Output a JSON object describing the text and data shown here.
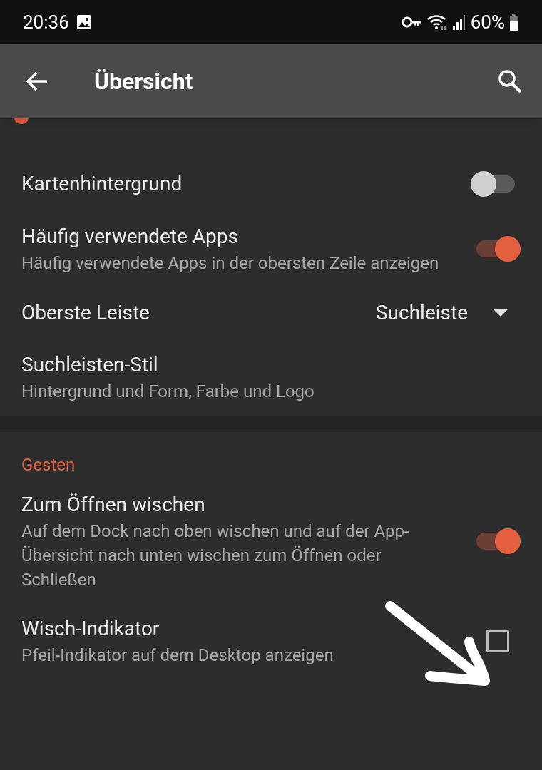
{
  "status_bar": {
    "time": "20:36",
    "battery": "60%"
  },
  "app_bar": {
    "title": "Übersicht"
  },
  "sections": [
    {
      "items": [
        {
          "kind": "toggle",
          "title": "Kartenhintergrund",
          "on": false
        },
        {
          "kind": "toggle",
          "title": "Häufig verwendete Apps",
          "subtitle": "Häufig verwendete Apps in der obersten Zeile anzeigen",
          "on": true
        },
        {
          "kind": "dropdown",
          "title": "Oberste Leiste",
          "value": "Suchleiste"
        },
        {
          "kind": "plain",
          "title": "Suchleisten-Stil",
          "subtitle": "Hintergrund und Form, Farbe und Logo"
        }
      ]
    },
    {
      "header": "Gesten",
      "items": [
        {
          "kind": "toggle",
          "title": "Zum Öffnen wischen",
          "subtitle": "Auf dem Dock nach oben wischen und auf der App-Übersicht nach unten wischen zum Öffnen oder Schließen",
          "on": true
        },
        {
          "kind": "checkbox",
          "title": "Wisch-Indikator",
          "subtitle": "Pfeil-Indikator auf dem Desktop anzeigen",
          "checked": false
        }
      ]
    }
  ]
}
